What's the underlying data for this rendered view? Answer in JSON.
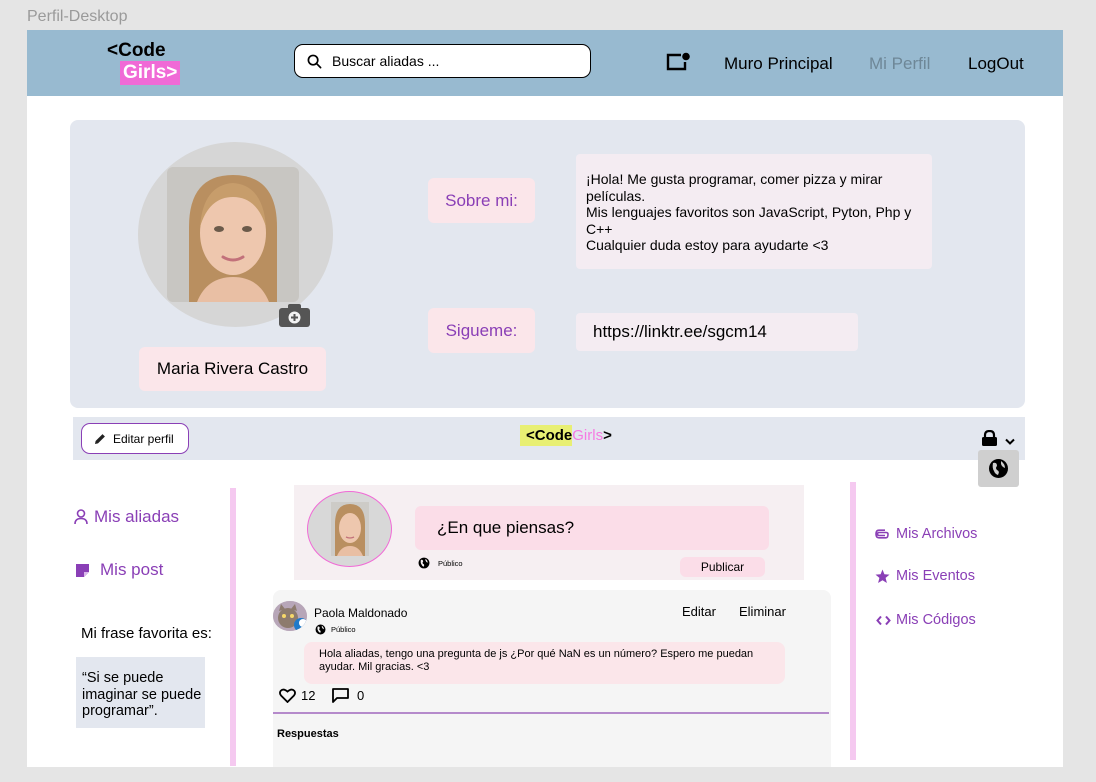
{
  "frame_label": "Perfil-Desktop",
  "header": {
    "logo_line1": "<Code",
    "logo_line2": "Girls>",
    "search_placeholder": "Buscar aliadas ...",
    "nav": {
      "wall": "Muro Principal",
      "profile": "Mi Perfil",
      "logout": "LogOut"
    }
  },
  "profile": {
    "name": "Maria Rivera Castro",
    "about_label": "Sobre mi:",
    "about_text": "¡Hola! Me gusta programar, comer pizza y mirar películas.\nMis lenguajes favoritos son JavaScript, Pyton, Php y C++\nCualquier duda estoy para ayudarte <3",
    "follow_label": "Sigueme:",
    "link": "https://linktr.ee/sgcm14"
  },
  "profile_bar": {
    "edit_label": "Editar perfil",
    "logo_code": "<Code",
    "logo_girls": "Girls",
    "logo_end": ">"
  },
  "left_sidebar": {
    "allies": "Mis aliadas",
    "posts": "Mis post",
    "fav_label": "Mi frase favorita es:",
    "quote": "“Si se puede imaginar se puede programar”."
  },
  "composer": {
    "placeholder": "¿En que piensas?",
    "privacy": "Público",
    "publish": "Publicar"
  },
  "post": {
    "author": "Paola Maldonado",
    "privacy": "Público",
    "edit": "Editar",
    "delete": "Eliminar",
    "text": "Hola aliadas, tengo una pregunta de js ¿Por qué NaN es un número? Espero me puedan ayudar. Mil gracias. <3",
    "likes": "12",
    "comments": "0",
    "replies_label": "Respuestas"
  },
  "right_sidebar": {
    "files": "Mis Archivos",
    "events": "Mis Eventos",
    "codes": "Mis Códigos"
  },
  "colors": {
    "header_bg": "#98bad0",
    "accent_purple": "#8a3fb6",
    "logo_pink": "#f06ad6",
    "card_bg": "#e3e7ef",
    "pill_pink": "#fbe6ea"
  }
}
